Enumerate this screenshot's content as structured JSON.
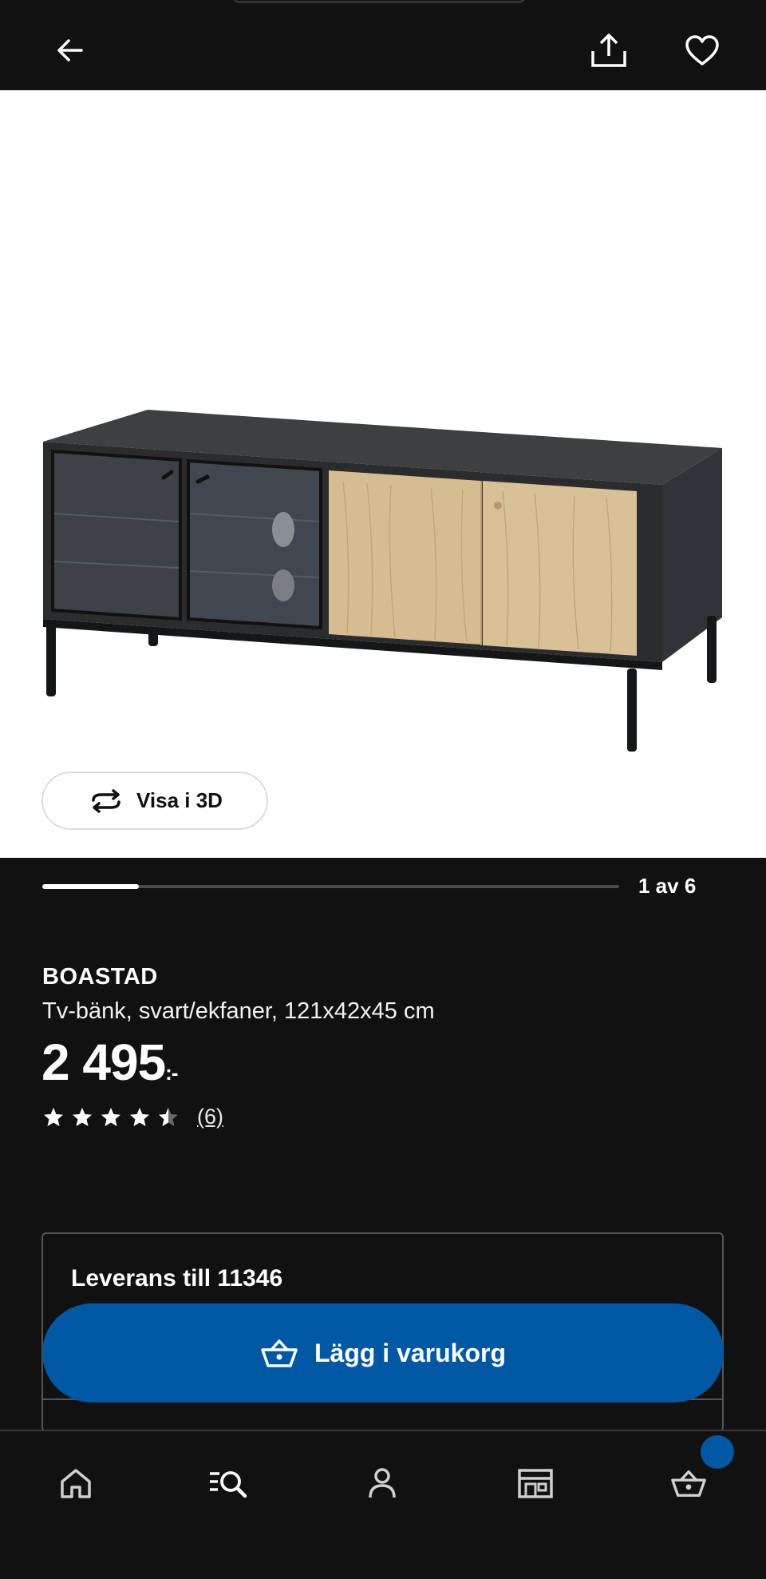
{
  "header": {
    "back_icon": "arrow-left-icon",
    "share_icon": "share-upload-icon",
    "favorite_icon": "heart-outline-icon"
  },
  "gallery": {
    "view_3d_label": "Visa i 3D",
    "view_3d_icon": "rotate-3d-icon",
    "counter": "1 av 6",
    "current": 1,
    "total": 6
  },
  "product": {
    "name": "BOASTAD",
    "description": "Tv-bänk, svart/ekfaner, 121x42x45 cm",
    "price": "2 495",
    "price_suffix": ":-",
    "rating": 4.5,
    "rating_max": 5,
    "review_count": "(6)"
  },
  "delivery": {
    "title": "Leverans till 11346"
  },
  "cart_button": {
    "label": "Lägg i varukorg",
    "icon": "basket-icon",
    "color": "#0058a3"
  },
  "bottom_nav": {
    "items": [
      "home-icon",
      "search-list-icon",
      "person-icon",
      "store-icon",
      "basket-icon"
    ],
    "badge_color": "#0058a3"
  }
}
